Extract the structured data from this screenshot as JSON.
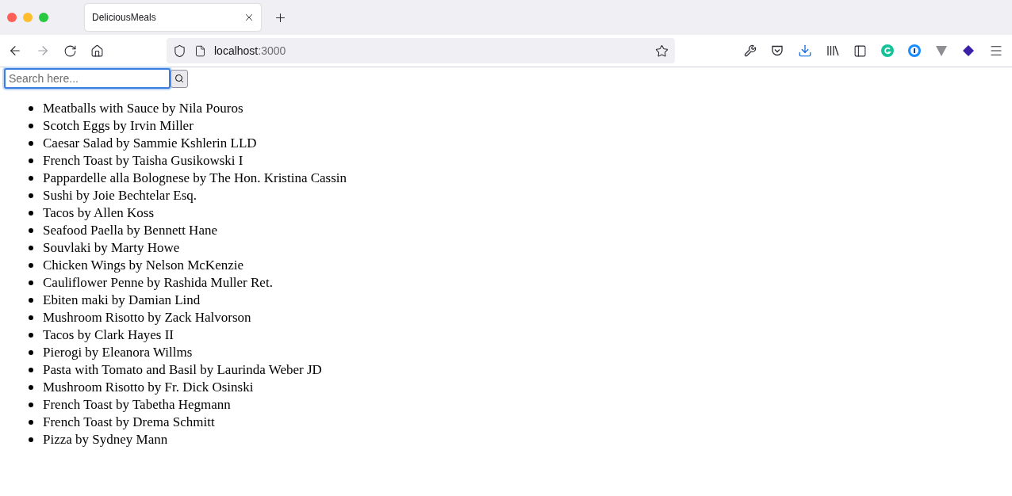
{
  "browser": {
    "tabs": [
      {
        "title": "DeliciousMeals",
        "selected": true
      }
    ],
    "address": {
      "host": "localhost",
      "port": ":3000"
    }
  },
  "search": {
    "placeholder": "Search here...",
    "focused": true
  },
  "recipes": [
    "Meatballs with Sauce by Nila Pouros",
    "Scotch Eggs by Irvin Miller",
    "Caesar Salad by Sammie Kshlerin LLD",
    "French Toast by Taisha Gusikowski I",
    "Pappardelle alla Bolognese by The Hon. Kristina Cassin",
    "Sushi by Joie Bechtelar Esq.",
    "Tacos by Allen Koss",
    "Seafood Paella by Bennett Hane",
    "Souvlaki by Marty Howe",
    "Chicken Wings by Nelson McKenzie",
    "Cauliflower Penne by Rashida Muller Ret.",
    "Ebiten maki by Damian Lind",
    "Mushroom Risotto by Zack Halvorson",
    "Tacos by Clark Hayes II",
    "Pierogi by Eleanora Willms",
    "Pasta with Tomato and Basil by Laurinda Weber JD",
    "Mushroom Risotto by Fr. Dick Osinski",
    "French Toast by Tabetha Hegmann",
    "French Toast by Drema Schmitt",
    "Pizza by Sydney Mann"
  ]
}
